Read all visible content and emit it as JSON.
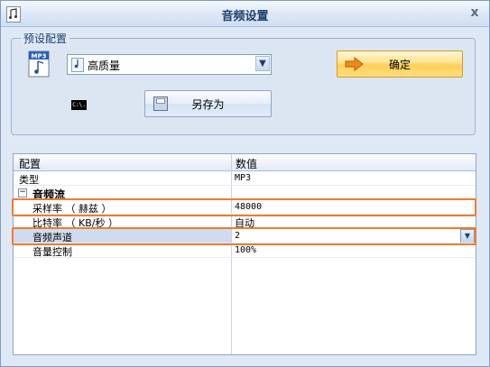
{
  "window": {
    "title": "音频设置",
    "close_label": "x"
  },
  "preset_group": {
    "legend": "预设配置",
    "selected_preset": "高质量",
    "confirm_label": "确定",
    "save_as_label": "另存为",
    "cmd_icon_text": "C:\\."
  },
  "grid": {
    "headers": [
      "配置",
      "数值"
    ],
    "rows": [
      {
        "name": "类型",
        "value": "MP3"
      },
      {
        "name": "音频流",
        "value": ""
      },
      {
        "name": "采样率 （ 赫兹 ）",
        "value": "48000"
      },
      {
        "name": "比特率 （ KB/秒 ）",
        "value": "自动"
      },
      {
        "name": "音频声道",
        "value": "2"
      },
      {
        "name": "音量控制",
        "value": "100%"
      }
    ],
    "expander_symbol": "−"
  },
  "colors": {
    "highlight": "#ee7c30",
    "title_text": "#1d3e6e"
  }
}
